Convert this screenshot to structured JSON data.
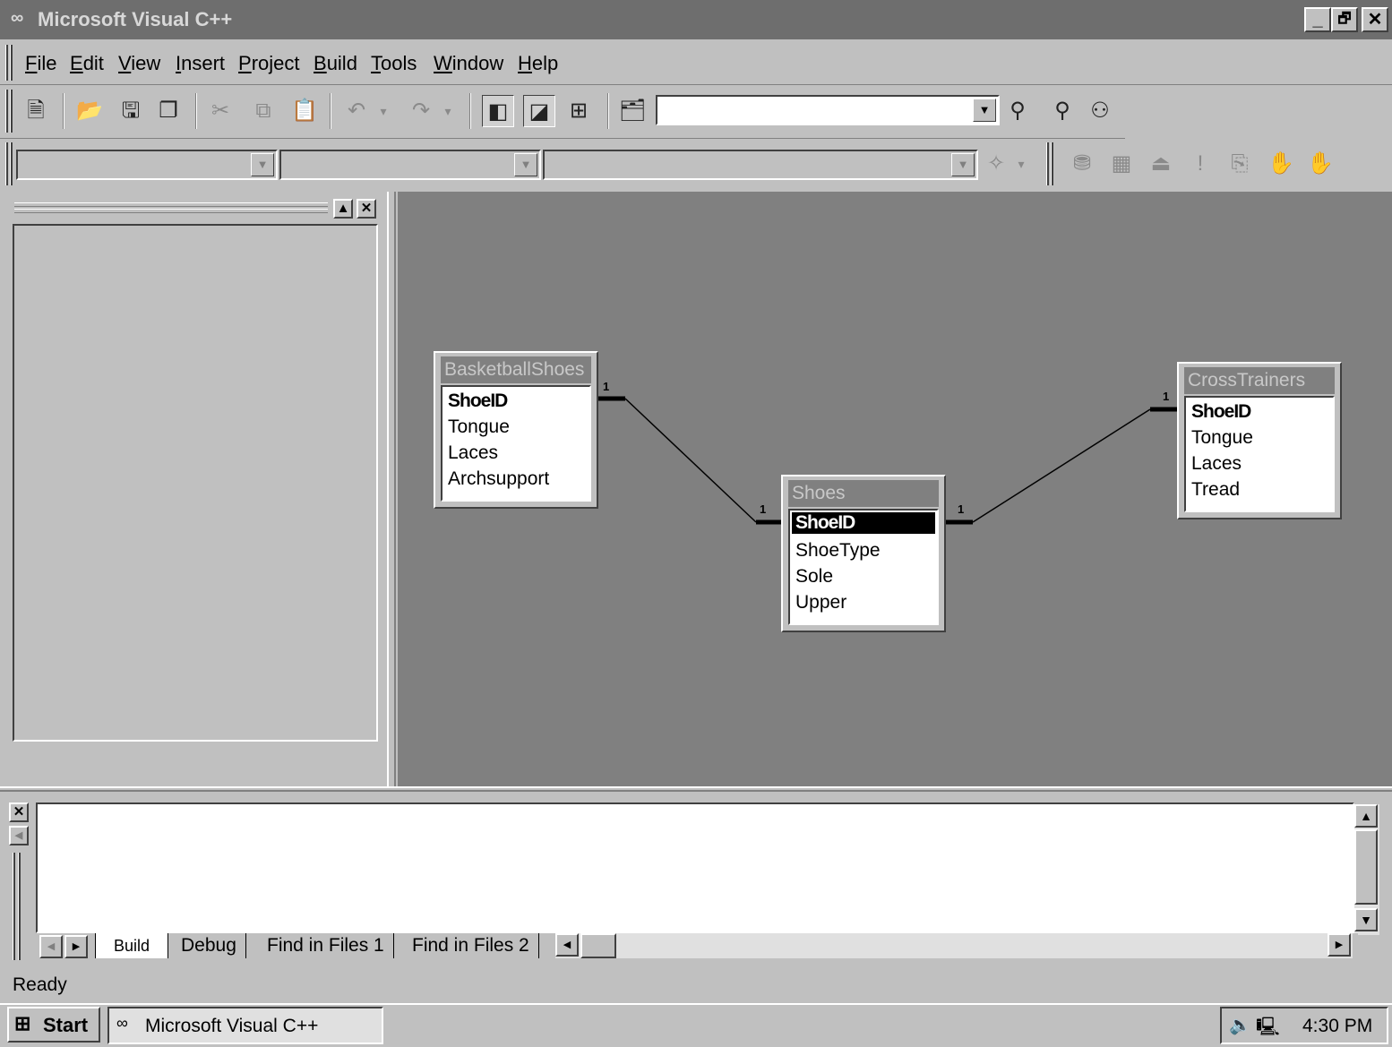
{
  "window": {
    "title": "Microsoft Visual C++",
    "app_icon": "vc-infinity-icon",
    "controls": {
      "minimize": "_",
      "maximize": "🗗",
      "close": "✕"
    }
  },
  "menu": [
    "File",
    "Edit",
    "View",
    "Insert",
    "Project",
    "Build",
    "Tools",
    "Window",
    "Help"
  ],
  "menu_mnemonics": [
    "F",
    "E",
    "V",
    "I",
    "P",
    "B",
    "T",
    "W",
    "H"
  ],
  "toolbar1": {
    "icons": [
      "new-text-file-icon",
      "open-folder-icon",
      "save-icon",
      "save-all-icon",
      "cut-icon",
      "copy-icon",
      "paste-icon",
      "undo-icon",
      "redo-icon",
      "workspace-icon",
      "output-icon",
      "window-list-icon",
      "find-in-files-icon",
      "find-icon",
      "find-next-icon",
      "find-binoculars-icon"
    ],
    "find_combo_value": ""
  },
  "toolbar2": {
    "combo1_value": "",
    "combo2_value": "",
    "combo3_value": "",
    "icons": [
      "wizard-icon",
      "compile-icon",
      "build-icon",
      "stop-build-icon",
      "execute-icon",
      "go-icon",
      "breakpoint-hand-icon",
      "remove-breakpoints-icon"
    ]
  },
  "diagram": {
    "tables": [
      {
        "name": "BasketballShoes",
        "fields": [
          "ShoeID",
          "Tongue",
          "Laces",
          "Archsupport"
        ],
        "key_field": "ShoeID"
      },
      {
        "name": "Shoes",
        "fields": [
          "ShoeID",
          "ShoeType",
          "Sole",
          "Upper"
        ],
        "key_field": "ShoeID",
        "selected_field": "ShoeID"
      },
      {
        "name": "CrossTrainers",
        "fields": [
          "ShoeID",
          "Tongue",
          "Laces",
          "Tread"
        ],
        "key_field": "ShoeID"
      }
    ],
    "relationships": [
      {
        "from": "BasketballShoes",
        "to": "Shoes",
        "from_label": "1",
        "to_label": "1"
      },
      {
        "from": "Shoes",
        "to": "CrossTrainers",
        "from_label": "1",
        "to_label": "1"
      }
    ]
  },
  "output": {
    "tabs": [
      "Build",
      "Debug",
      "Find in Files 1",
      "Find in Files 2"
    ],
    "active_tab": "Build",
    "text": ""
  },
  "status": "Ready",
  "taskbar": {
    "start": "Start",
    "task": "Microsoft Visual C++",
    "clock": "4:30 PM"
  },
  "colors": {
    "title_bar": "#6e6e6e",
    "face": "#c0c0c0",
    "diagram_bg": "#808080"
  }
}
